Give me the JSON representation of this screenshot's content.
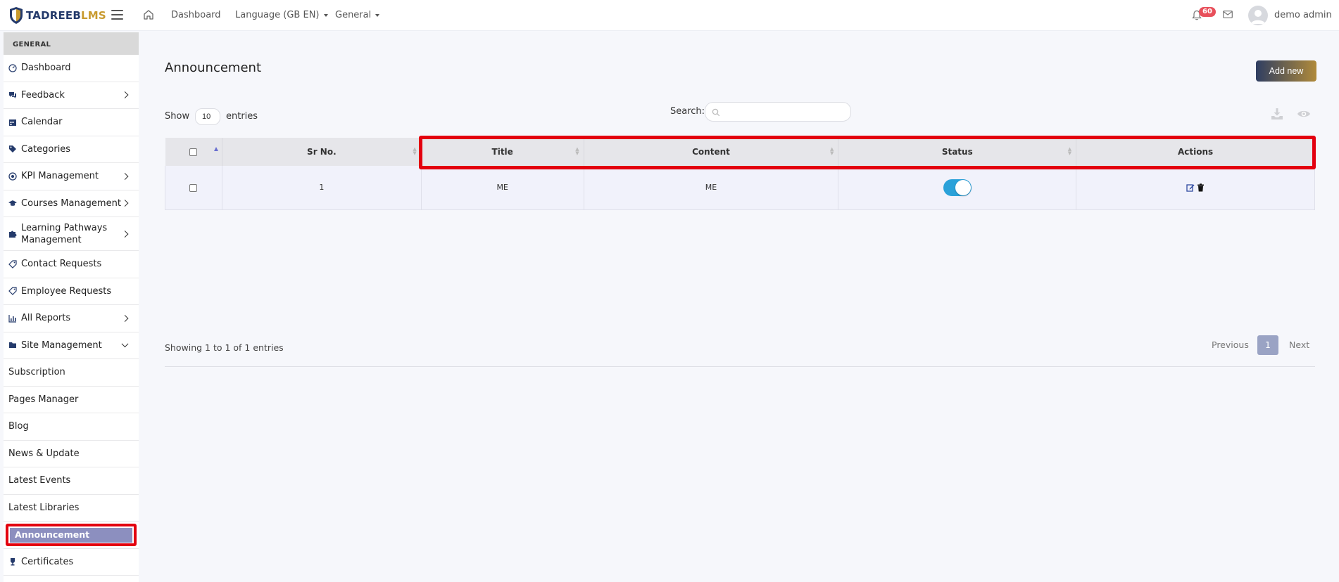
{
  "header": {
    "logo_part1": "TADREEB",
    "logo_part2": "LMS",
    "nav_dashboard": "Dashboard",
    "nav_language": "Language (GB EN)",
    "nav_general": "General",
    "notification_count": "60",
    "user_name": "demo admin"
  },
  "sidebar": {
    "section_title": "GENERAL",
    "items": [
      {
        "label": "Dashboard",
        "icon": "dashboard-gauge-icon"
      },
      {
        "label": "Feedback",
        "icon": "comments-icon",
        "has_submenu": true
      },
      {
        "label": "Calendar",
        "icon": "calendar-icon"
      },
      {
        "label": "Categories",
        "icon": "tags-icon"
      },
      {
        "label": "KPI Management",
        "icon": "target-icon",
        "has_submenu": true
      },
      {
        "label": "Courses Management",
        "icon": "graduation-cap-icon",
        "has_submenu": true
      },
      {
        "label": "Learning Pathways Management",
        "icon": "puzzle-icon",
        "has_submenu": true
      },
      {
        "label": "Contact Requests",
        "icon": "tag-icon"
      },
      {
        "label": "Employee Requests",
        "icon": "tag-icon"
      },
      {
        "label": "All Reports",
        "icon": "chart-icon",
        "has_submenu": true
      },
      {
        "label": "Site Management",
        "icon": "folder-icon",
        "has_submenu": true,
        "expanded": true
      }
    ],
    "sub_items": [
      "Subscription",
      "Pages Manager",
      "Blog",
      "News & Update",
      "Latest Events",
      "Latest Libraries"
    ],
    "active_item": "Announcement",
    "last_item": {
      "label": "Certificates",
      "icon": "trophy-icon"
    }
  },
  "main": {
    "title": "Announcement",
    "add_button": "Add new",
    "show_label": "Show",
    "entries_value": "10",
    "entries_label": "entries",
    "search_label": "Search:",
    "search_value": ""
  },
  "table": {
    "columns": [
      "Sr No.",
      "Title",
      "Content",
      "Status",
      "Actions"
    ],
    "rows": [
      {
        "sr": "1",
        "title": "ME",
        "content": "ME",
        "status_on": true
      }
    ]
  },
  "footer": {
    "info": "Showing 1 to 1 of 1 entries",
    "previous": "Previous",
    "current_page": "1",
    "next": "Next"
  },
  "colors": {
    "accent": "#8c8fbf",
    "highlight": "#e3000f",
    "toggle_on": "#2aa1d9",
    "badge": "#e8505b"
  }
}
